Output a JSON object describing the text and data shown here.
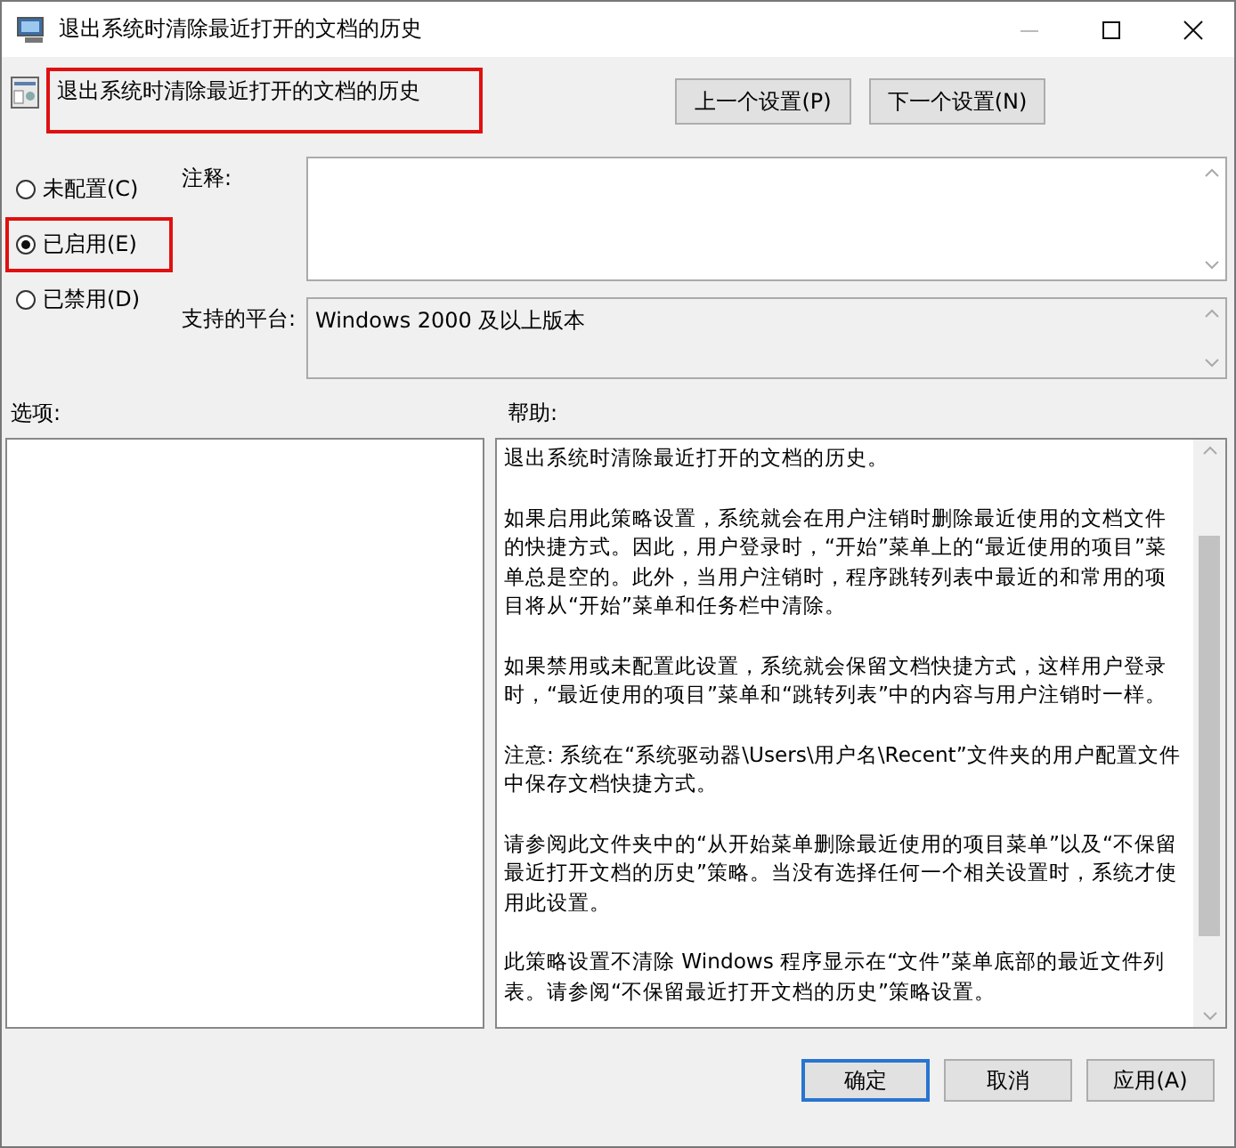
{
  "window": {
    "title": "退出系统时清除最近打开的文档的历史"
  },
  "setting": {
    "title": "退出系统时清除最近打开的文档的历史",
    "highlighted": true
  },
  "nav_buttons": [
    "上一个设置(P)",
    "下一个设置(N)"
  ],
  "state_options": [
    {
      "label": "未配置(C)",
      "selected": false,
      "highlighted": false
    },
    {
      "label": "已启用(E)",
      "selected": true,
      "highlighted": true
    },
    {
      "label": "已禁用(D)",
      "selected": false,
      "highlighted": false
    }
  ],
  "comment": {
    "label": "注释:"
  },
  "platform": {
    "label": "支持的平台:",
    "value": "Windows 2000 及以上版本"
  },
  "options": {
    "label": "选项:"
  },
  "help": {
    "label": "帮助:",
    "paragraphs": [
      "退出系统时清除最近打开的文档的历史。",
      "如果启用此策略设置，系统就会在用户注销时删除最近使用的文档文件的快捷方式。因此，用户登录时，“开始”菜单上的“最近使用的项目”菜单总是空的。此外，当用户注销时，程序跳转列表中最近的和常用的项目将从“开始”菜单和任务栏中清除。",
      "如果禁用或未配置此设置，系统就会保留文档快捷方式，这样用户登录时，“最近使用的项目”菜单和“跳转列表”中的内容与用户注销时一样。",
      "注意: 系统在“系统驱动器\\Users\\用户名\\Recent”文件夹的用户配置文件中保存文档快捷方式。",
      "请参阅此文件夹中的“从开始菜单删除最近使用的项目菜单”以及“不保留最近打开文档的历史”策略。当没有选择任何一个相关设置时，系统才使用此设置。",
      "此策略设置不清除 Windows 程序显示在“文件”菜单底部的最近文件列表。请参阅“不保留最近打开文档的历史”策略设置。"
    ]
  },
  "buttons": [
    {
      "label": "确定",
      "default": true
    },
    {
      "label": "取消",
      "default": false
    },
    {
      "label": "应用(A)",
      "default": false
    }
  ]
}
